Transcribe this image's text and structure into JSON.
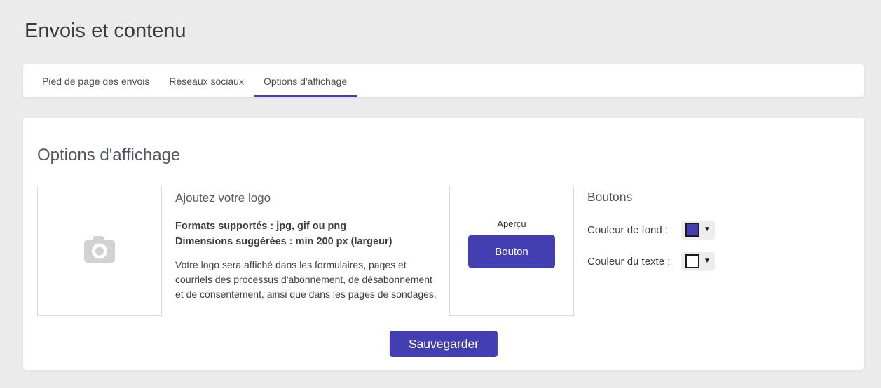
{
  "page": {
    "title": "Envois et contenu"
  },
  "tabs": [
    {
      "label": "Pied de page des envois",
      "active": false
    },
    {
      "label": "Réseaux sociaux",
      "active": false
    },
    {
      "label": "Options d'affichage",
      "active": true
    }
  ],
  "section": {
    "title": "Options d'affichage"
  },
  "logo": {
    "heading": "Ajoutez votre logo",
    "formats": "Formats supportés : jpg, gif ou png",
    "dimensions": "Dimensions suggérées : min 200 px (largeur)",
    "description": "Votre logo sera affiché dans les formulaires, pages et courriels des processus d'abonnement, de désabonnement et de consentement, ainsi que dans les pages de sondages.",
    "placeholder_icon": "camera-icon"
  },
  "preview": {
    "label": "Aperçu",
    "button_label": "Bouton"
  },
  "buttons_section": {
    "heading": "Boutons",
    "background_label": "Couleur de fond :",
    "background_color": "#433eb2",
    "text_label": "Couleur du texte :",
    "text_color": "#ffffff"
  },
  "actions": {
    "save_label": "Sauvegarder"
  },
  "icons": {
    "dropdown": "▼"
  },
  "colors": {
    "accent": "#433eb2",
    "page_background": "#ebebeb",
    "card_background": "#ffffff",
    "border": "#d9d9d9",
    "camera_icon": "#d2d2d2"
  }
}
